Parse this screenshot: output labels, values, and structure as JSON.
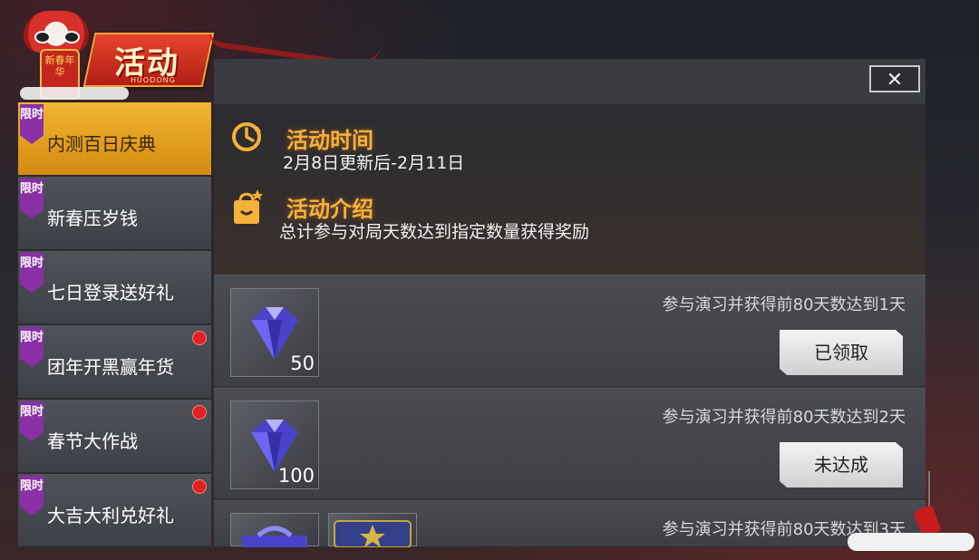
{
  "header": {
    "title": "活动",
    "subtitle": "HUODONG",
    "mascot_text": "新春年华"
  },
  "sidebar": {
    "tag_label": "限时",
    "items": [
      {
        "label": "内测百日庆典",
        "active": true,
        "dot": false
      },
      {
        "label": "新春压岁钱",
        "active": false,
        "dot": false
      },
      {
        "label": "七日登录送好礼",
        "active": false,
        "dot": false
      },
      {
        "label": "团年开黑赢年货",
        "active": false,
        "dot": true
      },
      {
        "label": "春节大作战",
        "active": false,
        "dot": true
      },
      {
        "label": "大吉大利兑好礼",
        "active": false,
        "dot": true
      }
    ]
  },
  "panel": {
    "close_label": "✕",
    "time_title": "活动时间",
    "time_text": "2月8日更新后-2月11日",
    "intro_title": "活动介绍",
    "intro_text": "总计参与对局天数达到指定数量获得奖励"
  },
  "rewards": [
    {
      "desc": "参与演习并获得前80天数达到1天",
      "qty": "50",
      "button": "已领取"
    },
    {
      "desc": "参与演习并获得前80天数达到2天",
      "qty": "100",
      "button": "未达成"
    },
    {
      "desc": "参与演习并获得前80天数达到3天",
      "qty": "",
      "button": ""
    }
  ],
  "colors": {
    "accent_gold": "#f0b632",
    "title_orange": "#f5b13a",
    "tag_purple": "#8a2fa6",
    "dot_red": "#e02222",
    "diamond_blue": "#5a52e0"
  },
  "icons": {
    "time": "clock-icon",
    "intro": "gift-bag-icon",
    "close": "close-icon",
    "reward": "diamond-icon"
  }
}
